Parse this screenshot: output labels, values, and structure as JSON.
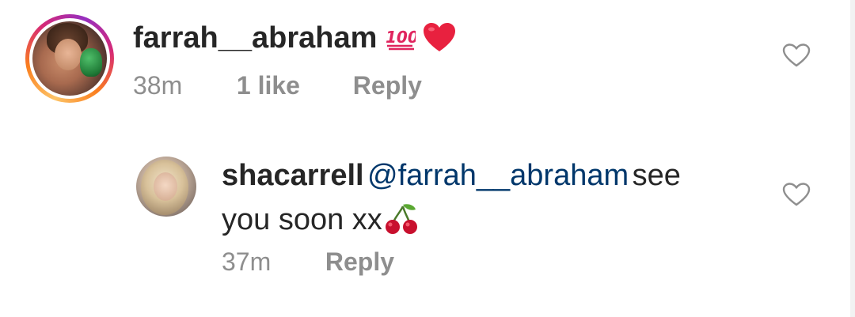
{
  "comments": [
    {
      "username": "farrah__abraham",
      "emoji_hundred": "💯",
      "emoji_heart": "❤",
      "time": "38m",
      "likes": "1 like",
      "reply_label": "Reply"
    }
  ],
  "replies": [
    {
      "username": "shacarrell",
      "mention": "@farrah__abraham",
      "text_after_mention": "see",
      "text_line2": "you soon xx",
      "emoji": "🍒",
      "time": "37m",
      "reply_label": "Reply"
    }
  ],
  "icons": {
    "like": "heart-outline-icon",
    "avatar": "profile-avatar"
  },
  "colors": {
    "text": "#262626",
    "mention": "#00376b",
    "secondary": "#8e8e8e",
    "heart_emoji": "#e0245e",
    "hundred_emoji": "#e0245e"
  }
}
